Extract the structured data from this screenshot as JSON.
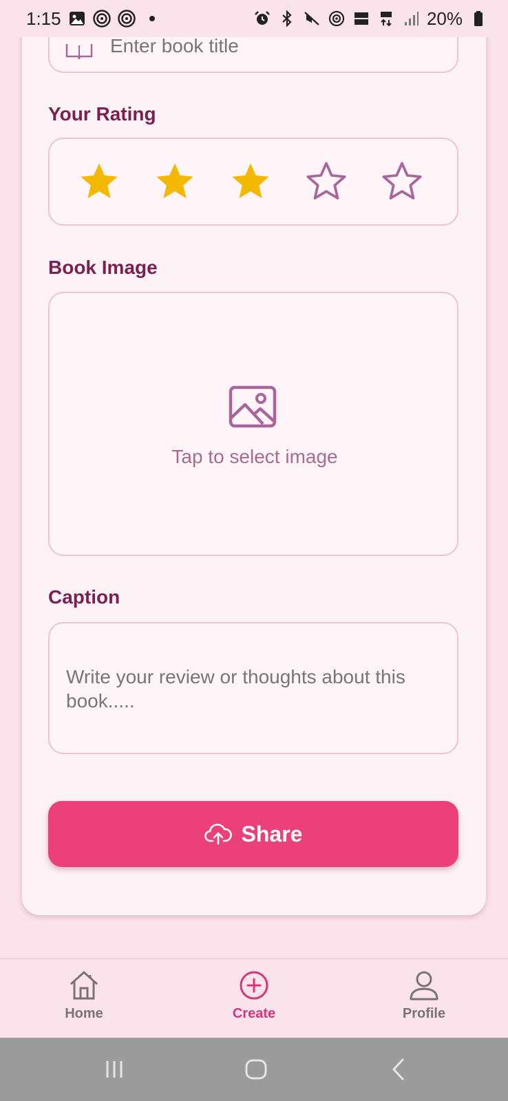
{
  "status_bar": {
    "time": "1:15",
    "battery": "20%"
  },
  "form": {
    "title_placeholder": "Enter book title",
    "rating_label": "Your Rating",
    "rating": {
      "value": 3,
      "max": 5
    },
    "image_label": "Book Image",
    "image_prompt": "Tap to select image",
    "caption_label": "Caption",
    "caption_placeholder": "Write your review or thoughts about this book.....",
    "share_label": "Share"
  },
  "bottom_nav": {
    "items": [
      {
        "label": "Home",
        "icon": "home-icon",
        "active": false
      },
      {
        "label": "Create",
        "icon": "plus-circle-icon",
        "active": true
      },
      {
        "label": "Profile",
        "icon": "person-icon",
        "active": false
      }
    ]
  },
  "colors": {
    "accent": "#ec407a",
    "label": "#7a1f4f",
    "star_filled": "#f5b800",
    "star_empty": "#a8669a"
  }
}
